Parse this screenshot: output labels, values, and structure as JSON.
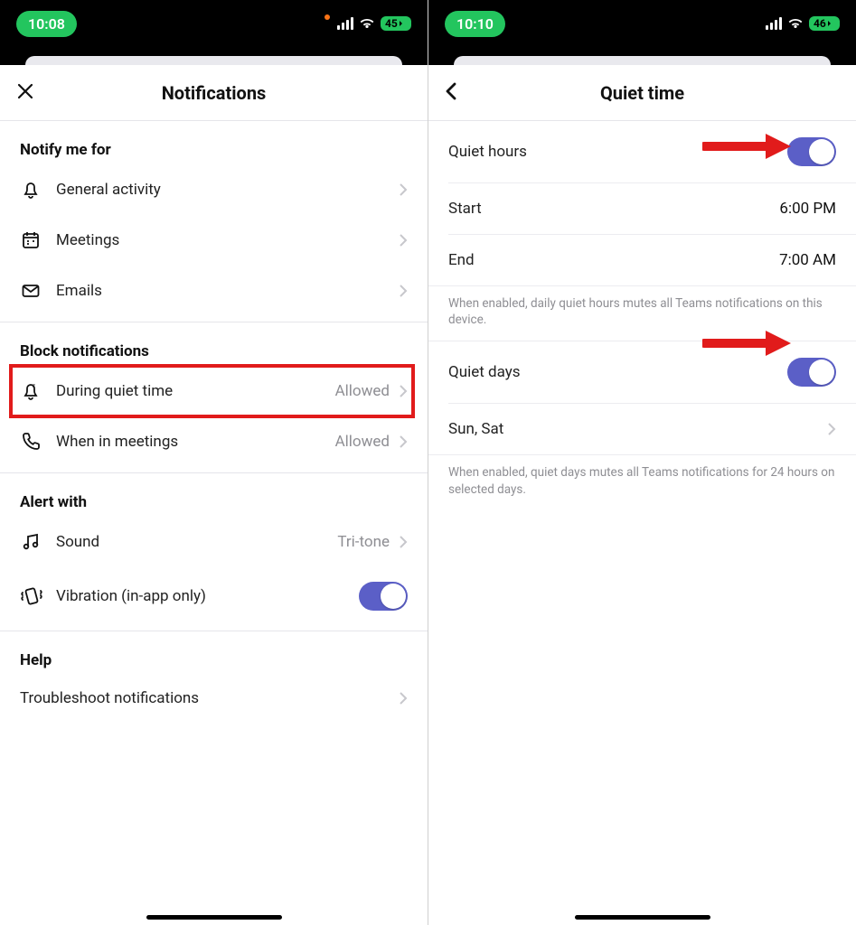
{
  "left": {
    "status": {
      "time": "10:08",
      "battery": "45"
    },
    "header": {
      "title": "Notifications"
    },
    "sections": {
      "notify_header": "Notify me for",
      "notify": [
        {
          "label": "General activity"
        },
        {
          "label": "Meetings"
        },
        {
          "label": "Emails"
        }
      ],
      "block_header": "Block notifications",
      "block": [
        {
          "label": "During quiet time",
          "value": "Allowed"
        },
        {
          "label": "When in meetings",
          "value": "Allowed"
        }
      ],
      "alert_header": "Alert with",
      "alert_sound": {
        "label": "Sound",
        "value": "Tri-tone"
      },
      "alert_vibration": {
        "label": "Vibration (in-app only)"
      },
      "help_header": "Help",
      "help_row": {
        "label": "Troubleshoot notifications"
      }
    }
  },
  "right": {
    "status": {
      "time": "10:10",
      "battery": "46"
    },
    "header": {
      "title": "Quiet time"
    },
    "quiet_hours": {
      "label": "Quiet hours",
      "start_label": "Start",
      "start_value": "6:00 PM",
      "end_label": "End",
      "end_value": "7:00 AM",
      "footnote": "When enabled, daily quiet hours mutes all Teams notifications on this device."
    },
    "quiet_days": {
      "label": "Quiet days",
      "days_value": "Sun, Sat",
      "footnote": "When enabled, quiet days mutes all Teams notifications for 24 hours on selected days."
    }
  }
}
